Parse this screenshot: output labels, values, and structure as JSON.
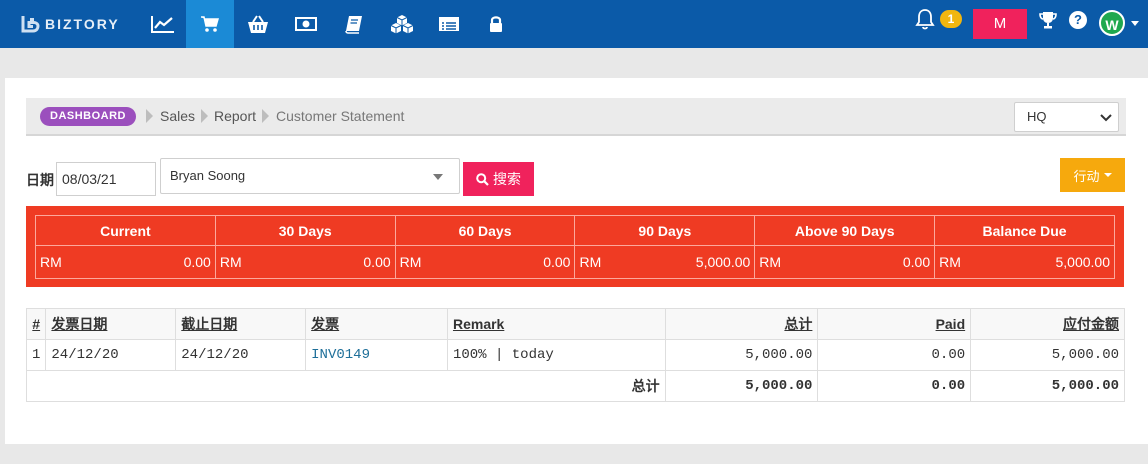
{
  "nav": {
    "brand": "BIZTORY",
    "icons": [
      "chart-line-icon",
      "shopping-cart-icon",
      "basket-icon",
      "money-icon",
      "book-icon",
      "cubes-icon",
      "list-icon",
      "lock-icon"
    ],
    "notification_count": "1",
    "m_button_label": "M",
    "avatar_initial": "W",
    "help_symbol": "?"
  },
  "breadcrumb": {
    "dashboard": "DASHBOARD",
    "items": [
      "Sales",
      "Report",
      "Customer Statement"
    ]
  },
  "branch": {
    "selected": "HQ"
  },
  "filters": {
    "date_label": "日期",
    "date_value": "08/03/21",
    "customer": "Bryan Soong",
    "search_label": "搜索",
    "action_label": "行动"
  },
  "aging": {
    "headers": [
      "Current",
      "30 Days",
      "60 Days",
      "90 Days",
      "Above 90 Days",
      "Balance Due"
    ],
    "currency": "RM",
    "values": [
      "0.00",
      "0.00",
      "0.00",
      "5,000.00",
      "0.00",
      "5,000.00"
    ]
  },
  "invoices": {
    "columns": [
      "#",
      "发票日期",
      "截止日期",
      "发票",
      "Remark",
      "总计",
      "Paid",
      "应付金额"
    ],
    "rows": [
      {
        "no": "1",
        "invoice_date": "24/12/20",
        "due_date": "24/12/20",
        "invoice": "INV0149",
        "remark": "100% | today",
        "total": "5,000.00",
        "paid": "0.00",
        "due": "5,000.00"
      }
    ],
    "footer": {
      "label": "总计",
      "total": "5,000.00",
      "paid": "0.00",
      "due": "5,000.00"
    }
  },
  "colors": {
    "nav_bg": "#0b5aa8",
    "nav_active": "#1b8ad6",
    "accent_pink": "#f0225c",
    "aging_red": "#ef3b23",
    "action_orange": "#f6a90d",
    "dashboard_purple": "#9b4fbd",
    "badge_yellow": "#f1b60f",
    "avatar_green": "#1fa84f"
  }
}
